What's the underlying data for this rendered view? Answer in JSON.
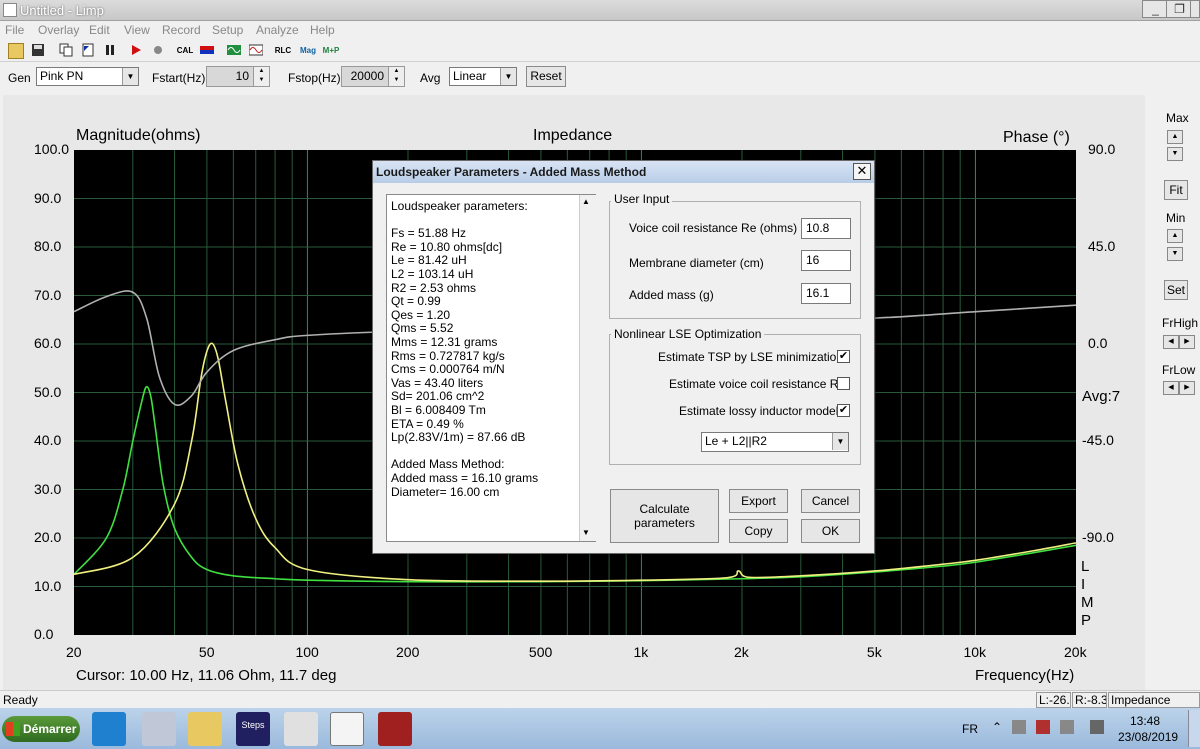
{
  "window": {
    "title": "Untitled - Limp",
    "minimize": "_",
    "maximize": "❐",
    "close": "✕"
  },
  "menu": [
    "File",
    "Overlay",
    "Edit",
    "View",
    "Record",
    "Setup",
    "Analyze",
    "Help"
  ],
  "toolbar": {
    "cal": "CAL",
    "rlc": "RLC",
    "mag": "Mag",
    "mp": "M+P"
  },
  "generator": {
    "gen_label": "Gen",
    "gen_value": "Pink PN",
    "fstart_label": "Fstart(Hz)",
    "fstart_value": "10",
    "fstop_label": "Fstop(Hz)",
    "fstop_value": "20000",
    "avg_label": "Avg",
    "avg_value": "Linear",
    "reset_label": "Reset"
  },
  "chart_data": {
    "type": "line",
    "title": "Impedance",
    "ylabel": "Magnitude(ohms)",
    "y2label": "Phase (°)",
    "xlabel": "Frequency(Hz)",
    "xscale": "log",
    "xlim": [
      20,
      20000
    ],
    "ylim": [
      0,
      100
    ],
    "y2lim": [
      -135,
      90
    ],
    "y_ticks": [
      "100.0",
      "90.0",
      "80.0",
      "70.0",
      "60.0",
      "50.0",
      "40.0",
      "30.0",
      "20.0",
      "10.0",
      "0.0"
    ],
    "y2_ticks": [
      "90.0",
      "45.0",
      "0.0",
      "-45.0",
      "-90.0"
    ],
    "x_ticks": [
      "20",
      "50",
      "100",
      "200",
      "500",
      "1k",
      "2k",
      "5k",
      "10k",
      "20k"
    ],
    "avg_label": "Avg:7",
    "limp_label": "L I M P",
    "grid": true,
    "series": [
      {
        "color": "#40e040",
        "x": [
          20,
          25,
          28,
          30,
          32,
          33,
          34,
          35,
          37,
          40,
          45,
          50,
          60,
          80,
          100,
          200,
          500,
          1000,
          2000,
          3000,
          5000,
          8000,
          10000,
          15000,
          20000
        ],
        "y": [
          12.5,
          20,
          30,
          40,
          48.5,
          51.2,
          49,
          43,
          31,
          22,
          16,
          13.5,
          12.2,
          11.6,
          11.3,
          11.0,
          11.0,
          11.2,
          11.6,
          12.0,
          13.0,
          14.2,
          15.0,
          17.0,
          18.5
        ]
      },
      {
        "color": "#f0f080",
        "x": [
          20,
          30,
          40,
          45,
          48,
          50,
          51.9,
          54,
          57,
          62,
          70,
          80,
          100,
          200,
          500,
          1000,
          1800,
          1950,
          2100,
          3000,
          5000,
          8000,
          10000,
          15000,
          20000
        ],
        "y": [
          12.5,
          16,
          27,
          40,
          53,
          58.5,
          60.1,
          57,
          48,
          35,
          24,
          18,
          13.5,
          11.4,
          11.1,
          11.3,
          11.8,
          13.2,
          11.9,
          12.2,
          13.2,
          14.6,
          15.4,
          17.4,
          19.0
        ]
      },
      {
        "color": "#b0b0b0",
        "axis": "phase",
        "x": [
          20,
          25,
          30,
          33,
          36,
          40,
          45,
          50,
          60,
          80,
          100,
          200,
          500,
          1000,
          2000,
          5000,
          10000,
          20000
        ],
        "y": [
          15,
          22,
          24,
          12,
          -15,
          -28,
          -24,
          -13,
          -3,
          2,
          4,
          6,
          7,
          8,
          10,
          12,
          15,
          18
        ]
      }
    ]
  },
  "cursor_text": "Cursor: 10.00 Hz, 11.06 Ohm, 11.7 deg",
  "right_panel": {
    "max": "Max",
    "fit": "Fit",
    "min": "Min",
    "set": "Set",
    "frhigh": "FrHigh",
    "frlow": "FrLow"
  },
  "dialog": {
    "title": "Loudspeaker Parameters - Added Mass Method",
    "params_lines": [
      "Loudspeaker parameters:",
      "",
      "Fs  = 51.88 Hz",
      "Re  = 10.80 ohms[dc]",
      "Le  = 81.42 uH",
      "L2  = 103.14 uH",
      "R2  = 2.53 ohms",
      "Qt  = 0.99",
      "Qes = 1.20",
      "Qms = 5.52",
      "Mms = 12.31 grams",
      "Rms = 0.727817 kg/s",
      "Cms = 0.000764 m/N",
      "Vas = 43.40 liters",
      "Sd= 201.06 cm^2",
      "Bl  = 6.008409 Tm",
      "ETA = 0.49 %",
      "Lp(2.83V/1m) = 87.66 dB",
      "",
      "Added Mass Method:",
      "Added mass = 16.10 grams",
      "Diameter= 16.00 cm"
    ],
    "user_input": {
      "title": "User Input",
      "re_label": "Voice coil resistance Re (ohms)",
      "re_value": "10.8",
      "diam_label": "Membrane diameter (cm)",
      "diam_value": "16",
      "mass_label": "Added mass (g)",
      "mass_value": "16.1"
    },
    "lse": {
      "title": "Nonlinear LSE Optimization",
      "opt1": "Estimate TSP by LSE minimization",
      "opt2": "Estimate voice coil resistance Re",
      "opt3": "Estimate lossy inductor model",
      "model_value": "Le + L2||R2"
    },
    "buttons": {
      "calculate": "Calculate parameters",
      "export": "Export",
      "cancel": "Cancel",
      "copy": "Copy",
      "ok": "OK"
    }
  },
  "status": {
    "ready": "Ready",
    "l_field": "L:-26.",
    "r_field": "R:-8.3",
    "mode": "Impedance Meas"
  },
  "taskbar": {
    "start": "Démarrer",
    "steps": "Steps",
    "lang": "FR",
    "time": "13:48",
    "date": "23/08/2019"
  }
}
